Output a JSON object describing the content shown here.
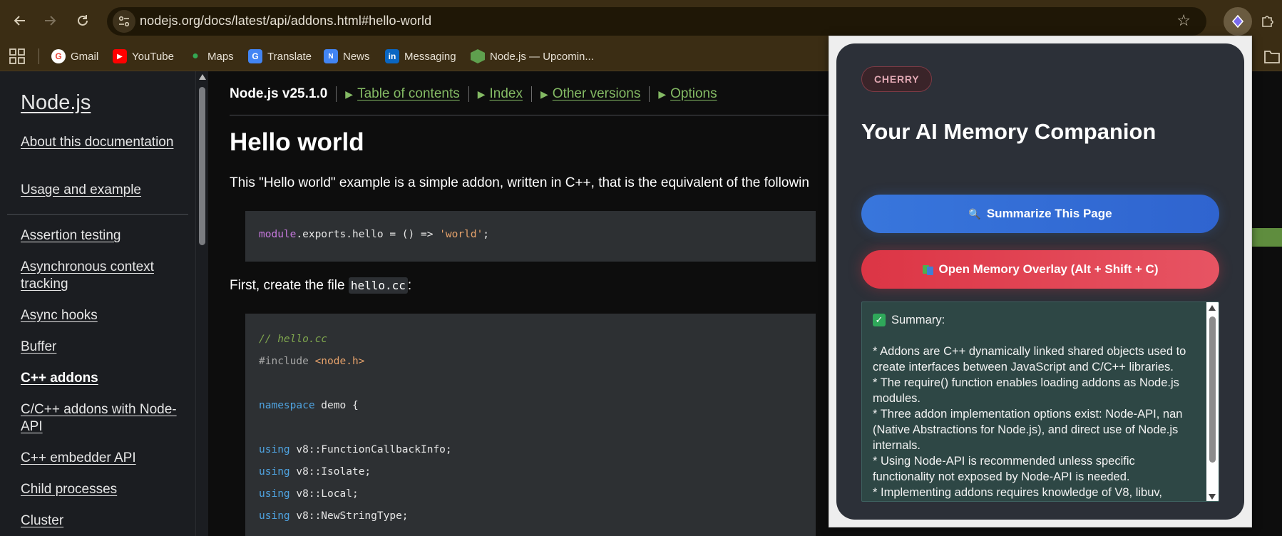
{
  "browser": {
    "url": "nodejs.org/docs/latest/api/addons.html#hello-world",
    "bookmarks": [
      {
        "label": "Gmail",
        "icon": "gmail-icon"
      },
      {
        "label": "YouTube",
        "icon": "youtube-icon"
      },
      {
        "label": "Maps",
        "icon": "maps-icon"
      },
      {
        "label": "Translate",
        "icon": "translate-icon"
      },
      {
        "label": "News",
        "icon": "news-icon"
      },
      {
        "label": "Messaging",
        "icon": "linkedin-icon"
      },
      {
        "label": "Node.js — Upcomin...",
        "icon": "nodejs-icon"
      }
    ]
  },
  "sidebar": {
    "title": "Node.js",
    "top_links": [
      "About this documentation",
      "Usage and example"
    ],
    "links": [
      "Assertion testing",
      "Asynchronous context tracking",
      "Async hooks",
      "Buffer",
      "C++ addons",
      "C/C++ addons with Node-API",
      "C++ embedder API",
      "Child processes",
      "Cluster"
    ],
    "active": "C++ addons"
  },
  "doc": {
    "version": "Node.js v25.1.0",
    "nav": [
      "Table of contents",
      "Index",
      "Other versions",
      "Options"
    ],
    "heading": "Hello world",
    "intro": "This \"Hello world\" example is a simple addon, written in C++, that is the equivalent of the followin",
    "code1": {
      "obj": "module",
      "rest": ".exports.hello = () => ",
      "str": "'world'",
      "end": ";"
    },
    "create_text_before": "First, create the file ",
    "create_file": "hello.cc",
    "create_text_after": ":",
    "code2": {
      "comment": "// hello.cc",
      "include": "#include ",
      "include_file": "<node.h>",
      "ns_kw": "namespace",
      "ns_rest": " demo {",
      "using_lines": [
        "v8::FunctionCallbackInfo;",
        "v8::Isolate;",
        "v8::Local;",
        "v8::NewStringType;"
      ],
      "using_kw": "using"
    }
  },
  "popup": {
    "badge": "CHERRY",
    "title": "Your AI Memory Companion",
    "summarize_label": "Summarize This Page",
    "overlay_label": "Open Memory Overlay (Alt + Shift + C)",
    "summary_header": "Summary:",
    "summary_lines": [
      "* Addons are C++ dynamically linked shared objects used to create interfaces between JavaScript and C/C++ libraries.",
      "* The require() function enables loading addons as Node.js modules.",
      "* Three addon implementation options exist: Node-API, nan (Native Abstractions for Node.js), and direct use of Node.js internals.",
      "* Using Node-API is recommended unless specific functionality not exposed by Node-API is needed.",
      "* Implementing addons requires knowledge of V8, libuv,"
    ],
    "colors": {
      "blue": "#3876dc",
      "red": "#dc3545",
      "badge": "#e0a7b2",
      "panel": "#2c3038"
    }
  }
}
